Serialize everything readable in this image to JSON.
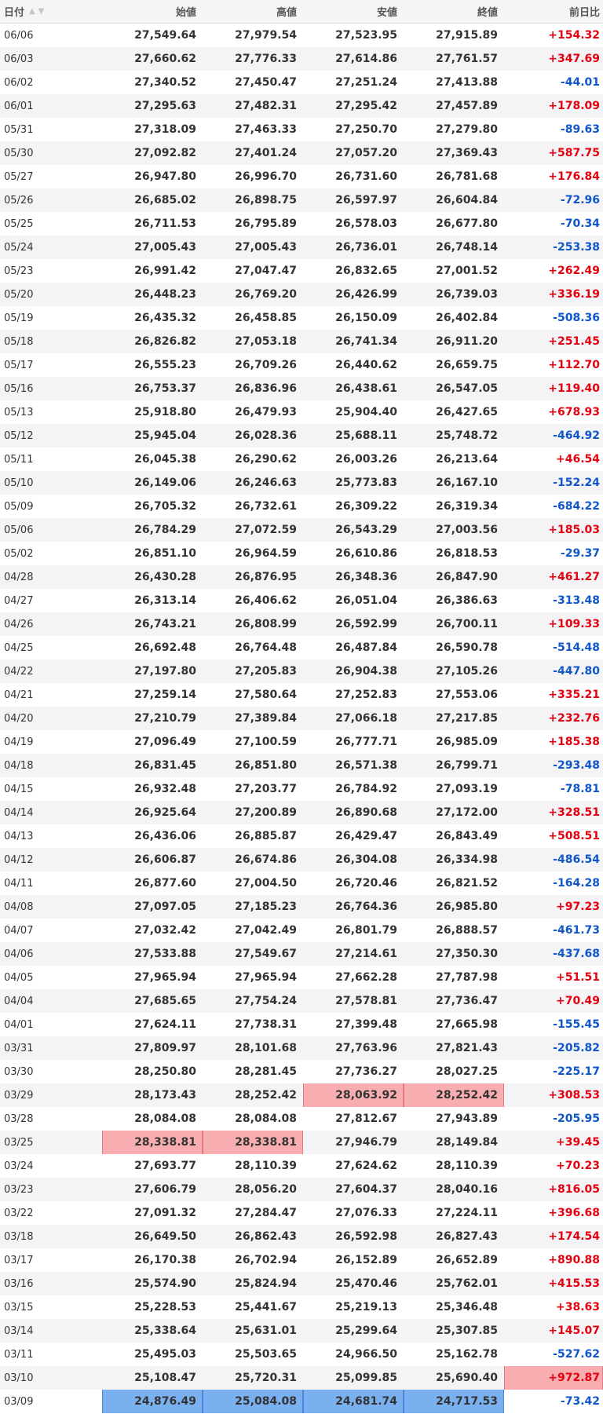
{
  "colors": {
    "up": "#e3000f",
    "down": "#0e56c9",
    "highlight_high": "#f8aeb0",
    "highlight_low": "#7ab0ef"
  },
  "headers": {
    "date": "日付",
    "open": "始値",
    "high": "高値",
    "low": "安値",
    "close": "終値",
    "change": "前日比"
  },
  "sort_icons": [
    "sort-asc-icon",
    "sort-desc-icon"
  ],
  "rows": [
    [
      "06/06",
      "27,549.64",
      "27,979.54",
      "27,523.95",
      "27,915.89",
      "+154.32"
    ],
    [
      "06/03",
      "27,660.62",
      "27,776.33",
      "27,614.86",
      "27,761.57",
      "+347.69"
    ],
    [
      "06/02",
      "27,340.52",
      "27,450.47",
      "27,251.24",
      "27,413.88",
      "-44.01"
    ],
    [
      "06/01",
      "27,295.63",
      "27,482.31",
      "27,295.42",
      "27,457.89",
      "+178.09"
    ],
    [
      "05/31",
      "27,318.09",
      "27,463.33",
      "27,250.70",
      "27,279.80",
      "-89.63"
    ],
    [
      "05/30",
      "27,092.82",
      "27,401.24",
      "27,057.20",
      "27,369.43",
      "+587.75"
    ],
    [
      "05/27",
      "26,947.80",
      "26,996.70",
      "26,731.60",
      "26,781.68",
      "+176.84"
    ],
    [
      "05/26",
      "26,685.02",
      "26,898.75",
      "26,597.97",
      "26,604.84",
      "-72.96"
    ],
    [
      "05/25",
      "26,711.53",
      "26,795.89",
      "26,578.03",
      "26,677.80",
      "-70.34"
    ],
    [
      "05/24",
      "27,005.43",
      "27,005.43",
      "26,736.01",
      "26,748.14",
      "-253.38"
    ],
    [
      "05/23",
      "26,991.42",
      "27,047.47",
      "26,832.65",
      "27,001.52",
      "+262.49"
    ],
    [
      "05/20",
      "26,448.23",
      "26,769.20",
      "26,426.99",
      "26,739.03",
      "+336.19"
    ],
    [
      "05/19",
      "26,435.32",
      "26,458.85",
      "26,150.09",
      "26,402.84",
      "-508.36"
    ],
    [
      "05/18",
      "26,826.82",
      "27,053.18",
      "26,741.34",
      "26,911.20",
      "+251.45"
    ],
    [
      "05/17",
      "26,555.23",
      "26,709.26",
      "26,440.62",
      "26,659.75",
      "+112.70"
    ],
    [
      "05/16",
      "26,753.37",
      "26,836.96",
      "26,438.61",
      "26,547.05",
      "+119.40"
    ],
    [
      "05/13",
      "25,918.80",
      "26,479.93",
      "25,904.40",
      "26,427.65",
      "+678.93"
    ],
    [
      "05/12",
      "25,945.04",
      "26,028.36",
      "25,688.11",
      "25,748.72",
      "-464.92"
    ],
    [
      "05/11",
      "26,045.38",
      "26,290.62",
      "26,003.26",
      "26,213.64",
      "+46.54"
    ],
    [
      "05/10",
      "26,149.06",
      "26,246.63",
      "25,773.83",
      "26,167.10",
      "-152.24"
    ],
    [
      "05/09",
      "26,705.32",
      "26,732.61",
      "26,309.22",
      "26,319.34",
      "-684.22"
    ],
    [
      "05/06",
      "26,784.29",
      "27,072.59",
      "26,543.29",
      "27,003.56",
      "+185.03"
    ],
    [
      "05/02",
      "26,851.10",
      "26,964.59",
      "26,610.86",
      "26,818.53",
      "-29.37"
    ],
    [
      "04/28",
      "26,430.28",
      "26,876.95",
      "26,348.36",
      "26,847.90",
      "+461.27"
    ],
    [
      "04/27",
      "26,313.14",
      "26,406.62",
      "26,051.04",
      "26,386.63",
      "-313.48"
    ],
    [
      "04/26",
      "26,743.21",
      "26,808.99",
      "26,592.99",
      "26,700.11",
      "+109.33"
    ],
    [
      "04/25",
      "26,692.48",
      "26,764.48",
      "26,487.84",
      "26,590.78",
      "-514.48"
    ],
    [
      "04/22",
      "27,197.80",
      "27,205.83",
      "26,904.38",
      "27,105.26",
      "-447.80"
    ],
    [
      "04/21",
      "27,259.14",
      "27,580.64",
      "27,252.83",
      "27,553.06",
      "+335.21"
    ],
    [
      "04/20",
      "27,210.79",
      "27,389.84",
      "27,066.18",
      "27,217.85",
      "+232.76"
    ],
    [
      "04/19",
      "27,096.49",
      "27,100.59",
      "26,777.71",
      "26,985.09",
      "+185.38"
    ],
    [
      "04/18",
      "26,831.45",
      "26,851.80",
      "26,571.38",
      "26,799.71",
      "-293.48"
    ],
    [
      "04/15",
      "26,932.48",
      "27,203.77",
      "26,784.92",
      "27,093.19",
      "-78.81"
    ],
    [
      "04/14",
      "26,925.64",
      "27,200.89",
      "26,890.68",
      "27,172.00",
      "+328.51"
    ],
    [
      "04/13",
      "26,436.06",
      "26,885.87",
      "26,429.47",
      "26,843.49",
      "+508.51"
    ],
    [
      "04/12",
      "26,606.87",
      "26,674.86",
      "26,304.08",
      "26,334.98",
      "-486.54"
    ],
    [
      "04/11",
      "26,877.60",
      "27,004.50",
      "26,720.46",
      "26,821.52",
      "-164.28"
    ],
    [
      "04/08",
      "27,097.05",
      "27,185.23",
      "26,764.36",
      "26,985.80",
      "+97.23"
    ],
    [
      "04/07",
      "27,032.42",
      "27,042.49",
      "26,801.79",
      "26,888.57",
      "-461.73"
    ],
    [
      "04/06",
      "27,533.88",
      "27,549.67",
      "27,214.61",
      "27,350.30",
      "-437.68"
    ],
    [
      "04/05",
      "27,965.94",
      "27,965.94",
      "27,662.28",
      "27,787.98",
      "+51.51"
    ],
    [
      "04/04",
      "27,685.65",
      "27,754.24",
      "27,578.81",
      "27,736.47",
      "+70.49"
    ],
    [
      "04/01",
      "27,624.11",
      "27,738.31",
      "27,399.48",
      "27,665.98",
      "-155.45"
    ],
    [
      "03/31",
      "27,809.97",
      "28,101.68",
      "27,763.96",
      "27,821.43",
      "-205.82"
    ],
    [
      "03/30",
      "28,250.80",
      "28,281.45",
      "27,736.27",
      "28,027.25",
      "-225.17"
    ],
    [
      "03/29",
      "28,173.43",
      "28,252.42",
      "28,063.92",
      "28,252.42",
      "+308.53"
    ],
    [
      "03/28",
      "28,084.08",
      "28,084.08",
      "27,812.67",
      "27,943.89",
      "-205.95"
    ],
    [
      "03/25",
      "28,338.81",
      "28,338.81",
      "27,946.79",
      "28,149.84",
      "+39.45"
    ],
    [
      "03/24",
      "27,693.77",
      "28,110.39",
      "27,624.62",
      "28,110.39",
      "+70.23"
    ],
    [
      "03/23",
      "27,606.79",
      "28,056.20",
      "27,604.37",
      "28,040.16",
      "+816.05"
    ],
    [
      "03/22",
      "27,091.32",
      "27,284.47",
      "27,076.33",
      "27,224.11",
      "+396.68"
    ],
    [
      "03/18",
      "26,649.50",
      "26,862.43",
      "26,592.98",
      "26,827.43",
      "+174.54"
    ],
    [
      "03/17",
      "26,170.38",
      "26,702.94",
      "26,152.89",
      "26,652.89",
      "+890.88"
    ],
    [
      "03/16",
      "25,574.90",
      "25,824.94",
      "25,470.46",
      "25,762.01",
      "+415.53"
    ],
    [
      "03/15",
      "25,228.53",
      "25,441.67",
      "25,219.13",
      "25,346.48",
      "+38.63"
    ],
    [
      "03/14",
      "25,338.64",
      "25,631.01",
      "25,299.64",
      "25,307.85",
      "+145.07"
    ],
    [
      "03/11",
      "25,495.03",
      "25,503.65",
      "24,966.50",
      "25,162.78",
      "-527.62"
    ],
    [
      "03/10",
      "25,108.47",
      "25,720.31",
      "25,099.85",
      "25,690.40",
      "+972.87"
    ],
    [
      "03/09",
      "24,876.49",
      "25,084.08",
      "24,681.74",
      "24,717.53",
      "-73.42"
    ]
  ],
  "highlights": [
    {
      "date": "03/29",
      "columns": [
        "low",
        "close"
      ],
      "kind": "high"
    },
    {
      "date": "03/25",
      "columns": [
        "open",
        "high"
      ],
      "kind": "high"
    },
    {
      "date": "03/10",
      "columns": [
        "change"
      ],
      "kind": "high"
    },
    {
      "date": "03/09",
      "columns": [
        "open",
        "high",
        "low",
        "close"
      ],
      "kind": "low"
    }
  ]
}
